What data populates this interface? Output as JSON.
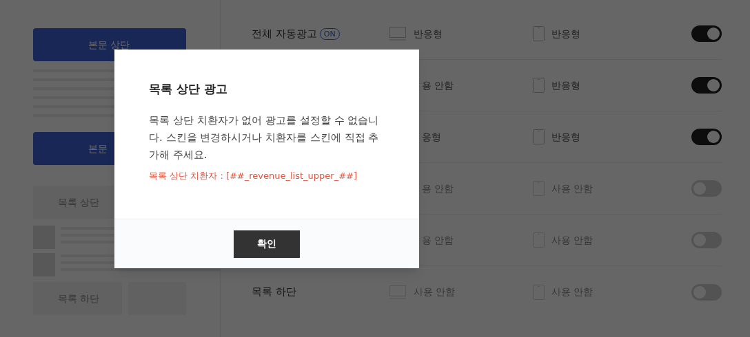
{
  "left_preview": {
    "blocks": [
      {
        "kind": "primary",
        "label": "본문 상단"
      },
      {
        "kind": "lines"
      },
      {
        "kind": "primary",
        "label": "본문"
      },
      {
        "kind": "secondary",
        "label": "목록 상단"
      },
      {
        "kind": "thumb_rows"
      },
      {
        "kind": "split",
        "label": "목록 하단"
      }
    ]
  },
  "placements": [
    {
      "label": "전체 자동광고",
      "badge": "ON",
      "pc": "반응형",
      "mobile": "반응형",
      "on": true,
      "pc_covered": false
    },
    {
      "pc": "용 안함",
      "mobile": "반응형",
      "on": true,
      "pc_covered": true
    },
    {
      "pc": "응형",
      "mobile": "반응형",
      "on": true,
      "pc_covered": true
    },
    {
      "pc": "용 안함",
      "mobile": "사용 안함",
      "on": false,
      "pc_covered": true
    },
    {
      "pc": "용 안함",
      "mobile": "사용 안함",
      "on": false,
      "pc_covered": true
    },
    {
      "label": "목록 하단",
      "pc": "사용 안함",
      "mobile": "사용 안함",
      "on": false,
      "pc_covered": false
    }
  ],
  "dialog": {
    "title": "목록 상단 광고",
    "message": "목록 상단 치환자가 없어 광고를 설정할 수 없습니다. 스킨을 변경하시거나 치환자를 스킨에 직접 추가해 주세요.",
    "note": "목록 상단 치환자 : [##_revenue_list_upper_##]",
    "buttons": [
      "확인"
    ]
  }
}
